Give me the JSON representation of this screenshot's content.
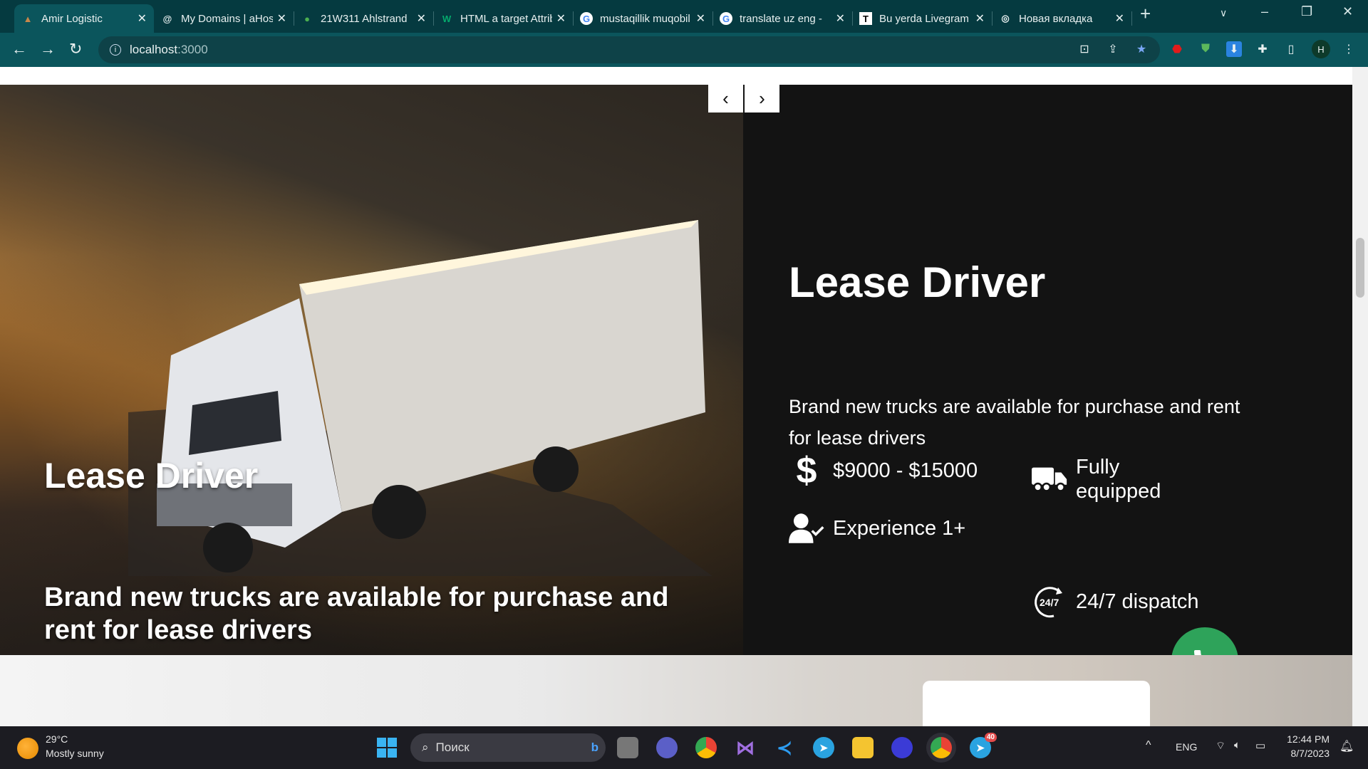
{
  "browser": {
    "tabs": [
      {
        "title": "Amir Logistic",
        "icon": "A",
        "active": true
      },
      {
        "title": "My Domains | aHost",
        "icon": "@"
      },
      {
        "title": "21W311 Ahlstrand",
        "icon": "◆"
      },
      {
        "title": "HTML a target Attribute",
        "icon": "W"
      },
      {
        "title": "mustaqillik muqobil",
        "icon": "G"
      },
      {
        "title": "translate uz eng - ",
        "icon": "G"
      },
      {
        "title": "Bu yerda Livegram",
        "icon": "T"
      },
      {
        "title": "Новая вкладка",
        "icon": "◎"
      }
    ],
    "new_tab": "+",
    "url_host": "localhost",
    "url_port": ":3000",
    "profile": "H"
  },
  "slider": {
    "prev": "‹",
    "next": "›"
  },
  "hero": {
    "image_title": "Lease Driver",
    "image_desc": "Brand new trucks are available for purchase and rent for lease drivers",
    "title": "Lease Driver",
    "desc": "Brand new trucks are available for purchase and rent for lease drivers",
    "features": [
      {
        "icon": "dollar-icon",
        "text": "$9000 - $15000"
      },
      {
        "icon": "truck-icon",
        "text": "Fully equipped"
      },
      {
        "icon": "user-check-icon",
        "text": "Experience 1+"
      },
      {
        "icon": "24-7-icon",
        "text": "24/7 dispatch"
      }
    ],
    "call_color": "#2ea35a"
  },
  "taskbar": {
    "weather_temp": "29°C",
    "weather_desc": "Mostly sunny",
    "search_placeholder": "Поиск",
    "lang": "ENG",
    "time": "12:44 PM",
    "date": "8/7/2023",
    "telegram_badge": "40"
  }
}
